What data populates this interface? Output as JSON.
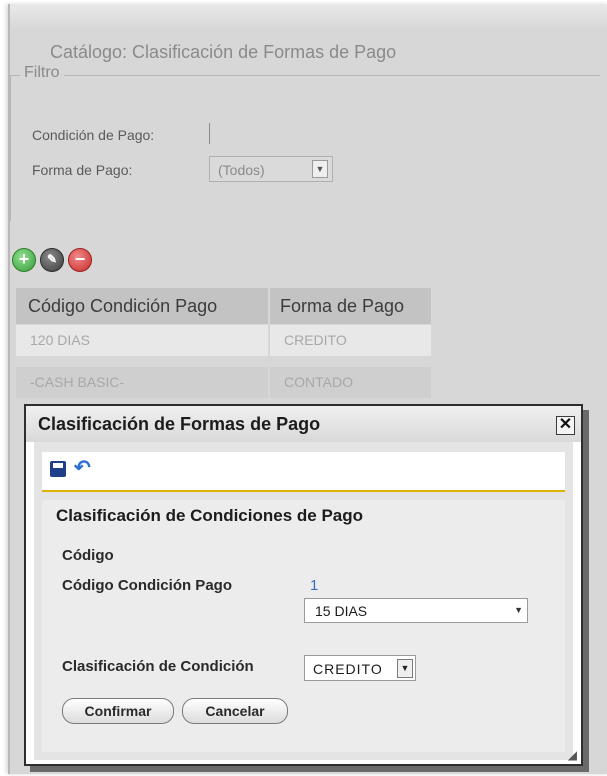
{
  "page": {
    "title": "Catálogo: Clasificación de Formas de Pago"
  },
  "filter": {
    "legend": "Filtro",
    "condition_label": "Condición de Pago:",
    "condition_value": "",
    "payment_form_label": "Forma de Pago:",
    "payment_form_value": "(Todos)"
  },
  "toolbar": {
    "icons": [
      "add-icon",
      "edit-icon",
      "delete-icon"
    ]
  },
  "grid": {
    "columns": [
      "Código Condición Pago",
      "Forma de Pago"
    ],
    "rows": [
      [
        "120 DIAS",
        "CREDITO"
      ],
      [
        "-CASH BASIC-",
        "CONTADO"
      ]
    ]
  },
  "dialog": {
    "title": "Clasificación de Formas de Pago",
    "close_glyph": "✕",
    "section_title": "Clasificación de Condiciones de Pago",
    "code_label": "Código",
    "condition_code_label": "Código Condición Pago",
    "condition_code_value": "1",
    "condition_select_value": "15 DIAS",
    "classification_label": "Clasificación de Condición",
    "classification_value": "CREDITO",
    "confirm_label": "Confirmar",
    "cancel_label": "Cancelar",
    "icons": [
      "save-icon",
      "undo-icon"
    ]
  },
  "colors": {
    "frame_bg": "#d7d7d7",
    "accent_line": "#e0b000",
    "link_blue": "#3a6fc0"
  }
}
